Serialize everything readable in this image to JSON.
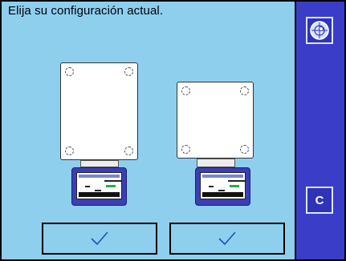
{
  "header": {
    "title": "Elija su configuración actual."
  },
  "sidebar": {
    "calibrate_icon": "level-target-icon",
    "c_label": "C"
  },
  "configs": [
    {
      "name": "large-pan-configuration",
      "icon": "checkmark-icon"
    },
    {
      "name": "small-pan-configuration",
      "icon": "checkmark-icon"
    }
  ],
  "terminal_display": {
    "value": "152.970 g"
  },
  "colors": {
    "background": "#8ecfee",
    "sidebar": "#3a3dc8",
    "terminal": "#3a3fb5",
    "accent_green": "#22b04a"
  }
}
